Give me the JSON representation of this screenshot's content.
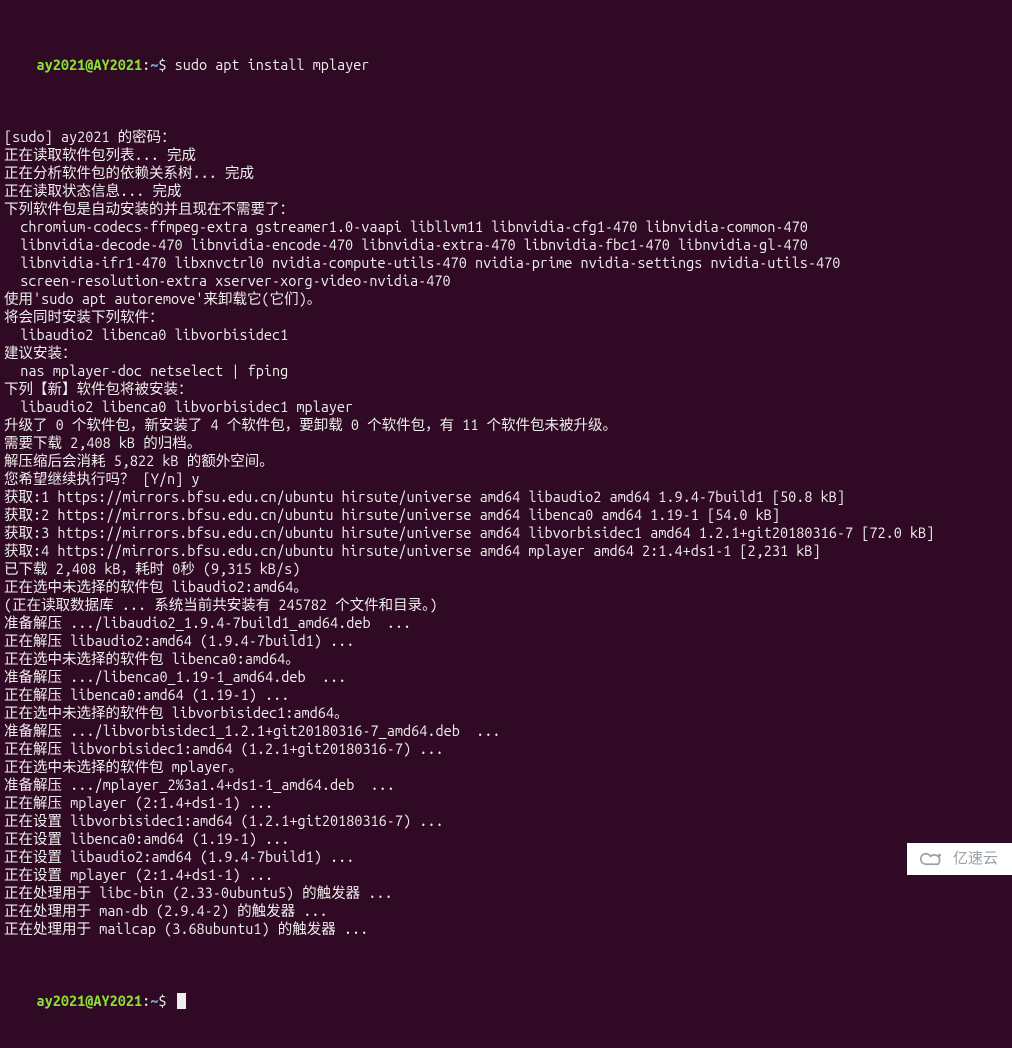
{
  "prompt": {
    "user": "ay2021",
    "at": "@",
    "host": "AY2021",
    "colon": ":",
    "path": "~",
    "dollar": "$ "
  },
  "command1": "sudo apt install mplayer",
  "lines": [
    "[sudo] ay2021 的密码：",
    "正在读取软件包列表... 完成",
    "正在分析软件包的依赖关系树... 完成",
    "正在读取状态信息... 完成",
    "下列软件包是自动安装的并且现在不需要了：",
    "  chromium-codecs-ffmpeg-extra gstreamer1.0-vaapi libllvm11 libnvidia-cfg1-470 libnvidia-common-470",
    "  libnvidia-decode-470 libnvidia-encode-470 libnvidia-extra-470 libnvidia-fbc1-470 libnvidia-gl-470",
    "  libnvidia-ifr1-470 libxnvctrl0 nvidia-compute-utils-470 nvidia-prime nvidia-settings nvidia-utils-470",
    "  screen-resolution-extra xserver-xorg-video-nvidia-470",
    "使用'sudo apt autoremove'来卸载它(它们)。",
    "将会同时安装下列软件：",
    "  libaudio2 libenca0 libvorbisidec1",
    "建议安装：",
    "  nas mplayer-doc netselect | fping",
    "下列【新】软件包将被安装：",
    "  libaudio2 libenca0 libvorbisidec1 mplayer",
    "升级了 0 个软件包，新安装了 4 个软件包，要卸载 0 个软件包，有 11 个软件包未被升级。",
    "需要下载 2,408 kB 的归档。",
    "解压缩后会消耗 5,822 kB 的额外空间。",
    "您希望继续执行吗？ [Y/n] y",
    "获取:1 https://mirrors.bfsu.edu.cn/ubuntu hirsute/universe amd64 libaudio2 amd64 1.9.4-7build1 [50.8 kB]",
    "获取:2 https://mirrors.bfsu.edu.cn/ubuntu hirsute/universe amd64 libenca0 amd64 1.19-1 [54.0 kB]",
    "获取:3 https://mirrors.bfsu.edu.cn/ubuntu hirsute/universe amd64 libvorbisidec1 amd64 1.2.1+git20180316-7 [72.0 kB]",
    "获取:4 https://mirrors.bfsu.edu.cn/ubuntu hirsute/universe amd64 mplayer amd64 2:1.4+ds1-1 [2,231 kB]",
    "已下载 2,408 kB，耗时 0秒 (9,315 kB/s)",
    "正在选中未选择的软件包 libaudio2:amd64。",
    "(正在读取数据库 ... 系统当前共安装有 245782 个文件和目录。)",
    "准备解压 .../libaudio2_1.9.4-7build1_amd64.deb  ...",
    "正在解压 libaudio2:amd64 (1.9.4-7build1) ...",
    "正在选中未选择的软件包 libenca0:amd64。",
    "准备解压 .../libenca0_1.19-1_amd64.deb  ...",
    "正在解压 libenca0:amd64 (1.19-1) ...",
    "正在选中未选择的软件包 libvorbisidec1:amd64。",
    "准备解压 .../libvorbisidec1_1.2.1+git20180316-7_amd64.deb  ...",
    "正在解压 libvorbisidec1:amd64 (1.2.1+git20180316-7) ...",
    "正在选中未选择的软件包 mplayer。",
    "准备解压 .../mplayer_2%3a1.4+ds1-1_amd64.deb  ...",
    "正在解压 mplayer (2:1.4+ds1-1) ...",
    "正在设置 libvorbisidec1:amd64 (1.2.1+git20180316-7) ...",
    "正在设置 libenca0:amd64 (1.19-1) ...",
    "正在设置 libaudio2:amd64 (1.9.4-7build1) ...",
    "正在设置 mplayer (2:1.4+ds1-1) ...",
    "正在处理用于 libc-bin (2.33-0ubuntu5) 的触发器 ...",
    "正在处理用于 man-db (2.9.4-2) 的触发器 ...",
    "正在处理用于 mailcap (3.68ubuntu1) 的触发器 ..."
  ],
  "watermark": "亿速云"
}
